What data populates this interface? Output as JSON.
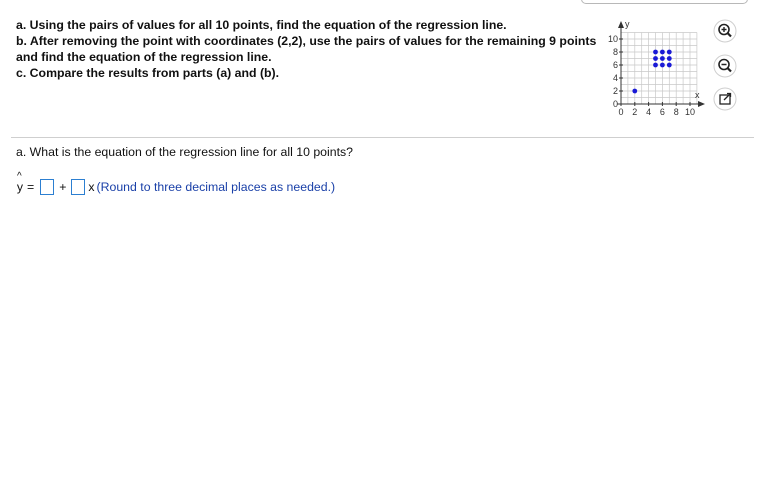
{
  "prompt": {
    "a": "a. Using the pairs of values for all 10 points, find the equation of the regression line.",
    "b": "b. After removing the point with coordinates (2,2), use the pairs of values for the remaining 9 points and find the equation of the regression line.",
    "c": "c. Compare the results from parts (a) and (b)."
  },
  "graph": {
    "y_label": "y",
    "x_label": "x",
    "y_ticks": [
      "10",
      "8",
      "6",
      "4",
      "2",
      "0"
    ],
    "x_ticks": [
      "0",
      "2",
      "4",
      "6",
      "8",
      "10"
    ],
    "xlim": [
      0,
      10
    ],
    "ylim": [
      0,
      10
    ],
    "points": [
      [
        2,
        2
      ],
      [
        5,
        6
      ],
      [
        6,
        6
      ],
      [
        7,
        6
      ],
      [
        5,
        7
      ],
      [
        6,
        7
      ],
      [
        7,
        7
      ],
      [
        5,
        8
      ],
      [
        6,
        8
      ],
      [
        7,
        8
      ]
    ],
    "point_color": "#1a1ad6"
  },
  "icons": [
    "zoom-in-icon",
    "zoom-out-icon",
    "popout-icon"
  ],
  "question": "a. What is the equation of the regression line for all 10 points?",
  "answer": {
    "yhat": "y",
    "hat": "^",
    "equals": "=",
    "plus": "+",
    "x": "x",
    "hint": "(Round to three decimal places as needed.)",
    "intercept_value": "",
    "slope_value": ""
  },
  "colors": {
    "accent": "#2c7fd1",
    "hint_text": "#1a40a8"
  }
}
